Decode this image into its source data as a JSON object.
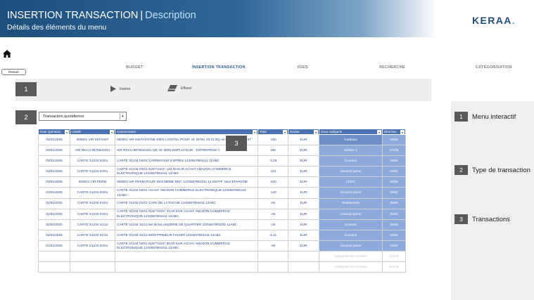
{
  "header": {
    "title_main": "INSERTION TRANSACTION",
    "title_sep": "|",
    "title_accent": "Description",
    "subtitle": "Détails des éléments du menu",
    "logo_text": "KERAA",
    "logo_dot": "."
  },
  "home_icon": "home-icon",
  "restart_label": "Restart",
  "nav": {
    "items": [
      "BUDGET",
      "INSERTION TRANSACTION",
      "VUES",
      "RECHERCHE",
      "CATÉGORISATION"
    ],
    "active_index": 1
  },
  "toolbar": {
    "step_badge": "1",
    "insert_label": "Insérer",
    "insert_icon": "play-icon",
    "delete_label": "Effacer",
    "delete_icon": "eraser-icon"
  },
  "type_section": {
    "step_badge": "2",
    "selected_value": "Transaction quotidienne"
  },
  "transactions": {
    "step_badge": "3",
    "columns": [
      "Date opération",
      "Libellé",
      "Commentaire",
      "Total",
      "Devise",
      "Sous-catégorie",
      "Direction"
    ],
    "rows": [
      {
        "date": "03/01/2025",
        "libelle": "000001 VIR INSTANT",
        "commentaire": "000001 VIR INSTANTANE EMIS LOGITEL POUR: M. INTEL 03 01 BQ mi 03/01/2025 17:37",
        "total": "-150",
        "devise": "EUR",
        "sous_categorie": "Cadeaux",
        "direction": "Débit"
      },
      {
        "date": "03/01/2025",
        "libelle": "VIR RECU 9876543321",
        "commentaire": "VIR RECU 9876543321 DE: M. MON EMPLOYEUR - ENTREPRISE A",
        "total": "150",
        "devise": "EUR",
        "sous_categorie": "Salaire 1",
        "direction": "Crédit"
      },
      {
        "date": "03/01/2025",
        "libelle": "CARTE X1234 02/01",
        "commentaire": "CARTE X1234 02/01 CARREFOUR EXPRES 1234567891011 12ABC",
        "total": "-4,06",
        "devise": "EUR",
        "sous_categorie": "Courses",
        "direction": "Débit"
      },
      {
        "date": "03/01/2025",
        "libelle": "CARTE X1234 02/01",
        "commentaire": "CARTE X1234 02/01 N26**4101* 110,00 EUR ACHAT AMAZON COMMERCE ELECTRONIQUE 1234567891011 12ABC",
        "total": "-110",
        "devise": "EUR",
        "sous_categorie": "Amazon prime",
        "direction": "Débit"
      },
      {
        "date": "03/01/2025",
        "libelle": "000001 VIR PERM",
        "commentaire": "000001 VIR PERM POUR: MOI MEME REF: 1234567891011 12 MOTIF: Mon EPARGNE",
        "total": "-200",
        "devise": "EUR",
        "sous_categorie": "LDDS",
        "direction": "Débit"
      },
      {
        "date": "03/01/2025",
        "libelle": "CARTE X1234 02/01",
        "commentaire": "CARTE X1234 02/01 ACHAT AMAZON COMMERCE ELECTRONIQUE 1234567891011 12ABC",
        "total": "-140",
        "devise": "EUR",
        "sous_categorie": "Amazon prime",
        "direction": "Débit"
      },
      {
        "date": "02/01/2025",
        "libelle": "CARTE X1234 01/01",
        "commentaire": "CARTE X1234 01/01 CAFE DE LA RUCHE 1234567891011 12ABC",
        "total": "-62",
        "devise": "EUR",
        "sous_categorie": "Restaurants",
        "direction": "Débit"
      },
      {
        "date": "02/01/2025",
        "libelle": "CARTE X1234 02/01",
        "commentaire": "CARTE X1234 02/01 N26**4101* 45,00 EUR ACHAT AMAZON COMMERCE ELECTRONIQUE 1234567891011 12ABC",
        "total": "-45",
        "devise": "EUR",
        "sous_categorie": "Amazon prime",
        "direction": "Débit"
      },
      {
        "date": "02/01/2025",
        "libelle": "CARTE X1234 31/12",
        "commentaire": "CARTE X1234 31/12 MA BOULANGERIE DE QUARTIER 1234567891011 12ABC",
        "total": "-26",
        "devise": "EUR",
        "sous_categorie": "Courses",
        "direction": "Débit"
      },
      {
        "date": "02/01/2025",
        "libelle": "CARTE X1234 31/12",
        "commentaire": "CARTE X1234 31/12 MON PRIMEUR FAVORI 1234567891011 12ABC",
        "total": "-6,11",
        "devise": "EUR",
        "sous_categorie": "Courses",
        "direction": "Débit"
      },
      {
        "date": "01/01/2025",
        "libelle": "CARTE X1234 02/01",
        "commentaire": "CARTE X1234 02/01 N26**4101* 90,00 EUR ACHAT AMAZON COMMERCE ELECTRONIQUE 1234567891011 12ABC",
        "total": "-90",
        "devise": "EUR",
        "sous_categorie": "Amazon prime",
        "direction": "Débit"
      },
      {
        "date": "",
        "libelle": "",
        "commentaire": "",
        "total": "",
        "devise": "",
        "sous_categorie": "Catégorie non trouvée",
        "direction": "Crédit"
      },
      {
        "date": "",
        "libelle": "",
        "commentaire": "",
        "total": "",
        "devise": "",
        "sous_categorie": "Catégorie non trouvée",
        "direction": "Crédit"
      }
    ]
  },
  "legend": {
    "items": [
      {
        "badge": "1",
        "label": "Menu interactif"
      },
      {
        "badge": "2",
        "label": "Type de transaction"
      },
      {
        "badge": "3",
        "label": "Transactions"
      }
    ]
  },
  "colors": {
    "header_dark": "#1d4f7c",
    "accent_blue": "#4a72b0",
    "subcategory_fill": "#8ea9db",
    "badge_grey": "#595959"
  }
}
